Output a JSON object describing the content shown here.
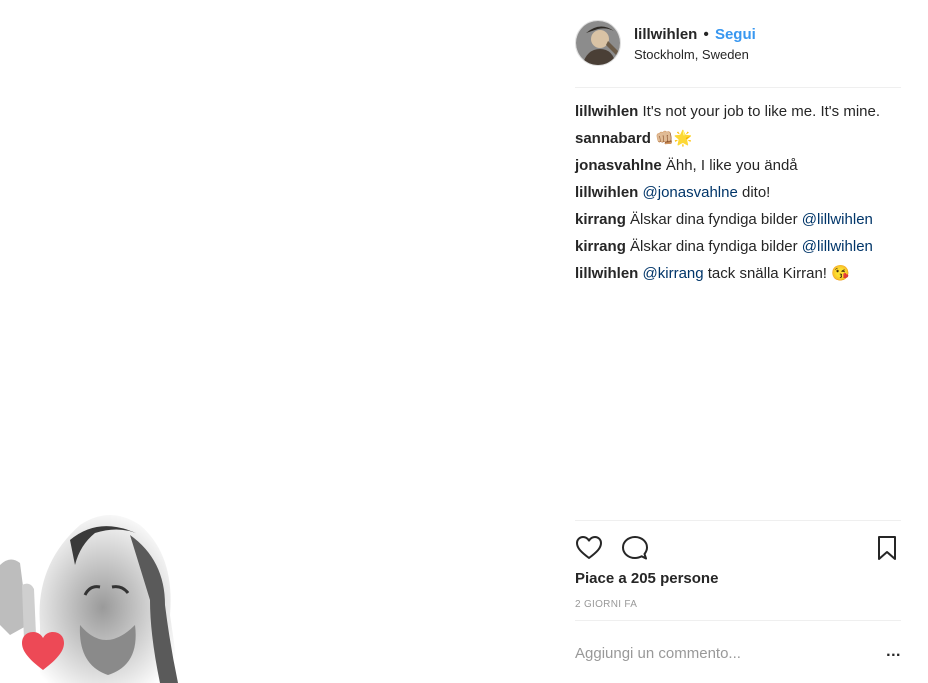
{
  "post": {
    "author": "lillwihlen",
    "separator": "•",
    "follow_label": "Segui",
    "location": "Stockholm, Sweden"
  },
  "comments": [
    {
      "user": "lillwihlen",
      "text": " It's not your job to like me. It's mine."
    },
    {
      "user": "sannabard",
      "text": " 👊🏼🌟"
    },
    {
      "user": "jonasvahlne",
      "text": " Ähh, I like you ändå"
    },
    {
      "user": "lillwihlen",
      "mention": "@jonasvahlne",
      "text": " dito!"
    },
    {
      "user": "kirrang",
      "text": " Älskar dina fyndiga bilder ",
      "mention": "@lillwihlen"
    },
    {
      "user": "kirrang",
      "text": " Älskar dina fyndiga bilder ",
      "mention": "@lillwihlen"
    },
    {
      "user": "lillwihlen",
      "mention": "@kirrang",
      "text": " tack snälla Kirran! 😘"
    }
  ],
  "actions": {
    "like_icon": "heart-outline-icon",
    "comment_icon": "speech-bubble-icon",
    "save_icon": "bookmark-icon"
  },
  "likes_text": "Piace a 205 persone",
  "timestamp": "2 giorni fa",
  "add_comment": {
    "placeholder": "Aggiungi un commento...",
    "more_label": "..."
  },
  "colors": {
    "follow": "#3897f0",
    "mention": "#003569",
    "heart": "#ed4956"
  }
}
